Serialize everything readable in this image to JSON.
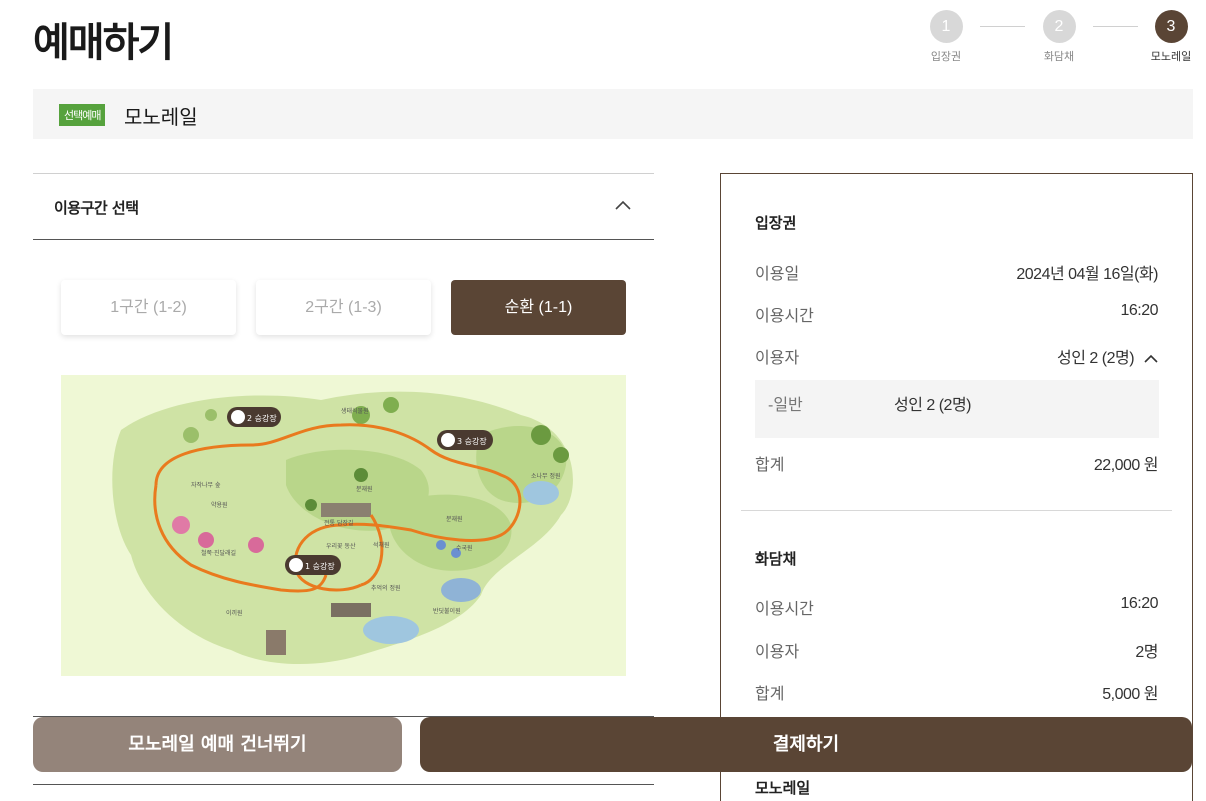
{
  "page": {
    "title": "예매하기"
  },
  "steps": [
    {
      "number": "1",
      "label": "입장권",
      "active": false
    },
    {
      "number": "2",
      "label": "화담채",
      "active": false
    },
    {
      "number": "3",
      "label": "모노레일",
      "active": true
    }
  ],
  "banner": {
    "tag": "선택예매",
    "title": "모노레일"
  },
  "route_section": {
    "title": "이용구간 선택",
    "options": [
      {
        "label": "1구간 (1-2)",
        "selected": false
      },
      {
        "label": "2구간 (1-3)",
        "selected": false
      },
      {
        "label": "순환 (1-1)",
        "selected": true
      }
    ]
  },
  "map": {
    "stations": [
      "1 승강장",
      "2 승강장",
      "3 승강장"
    ],
    "places": [
      "생태식물원",
      "자작나무 숲",
      "분재원",
      "소나무 정원",
      "철쭉·진달래길",
      "약용원",
      "전통 담장길",
      "우리꽃 동산",
      "석채원",
      "분재원",
      "수국원",
      "추억의 정원",
      "이끼원",
      "반딧불이원"
    ],
    "route_color": "#e97a1e"
  },
  "summary": {
    "admission": {
      "title": "입장권",
      "date_label": "이용일",
      "date_value": "2024년 04월 16일(화)",
      "time_label": "이용시간",
      "time_value": "16:20",
      "users_label": "이용자",
      "users_value": "성인 2 (2명)",
      "detail_label": "-일반",
      "detail_value": "성인 2 (2명)",
      "total_label": "합계",
      "total_value": "22,000 원"
    },
    "hwadamchae": {
      "title": "화담채",
      "time_label": "이용시간",
      "time_value": "16:20",
      "users_label": "이용자",
      "users_value": "2명",
      "total_label": "합계",
      "total_value": "5,000 원"
    },
    "monorail": {
      "title": "모노레일"
    }
  },
  "buttons": {
    "skip": "모노레일 예매 건너뛰기",
    "pay": "결제하기"
  },
  "colors": {
    "brand_brown": "#5a4535",
    "skip_button": "#94847a",
    "tag_green": "#56a23d"
  }
}
